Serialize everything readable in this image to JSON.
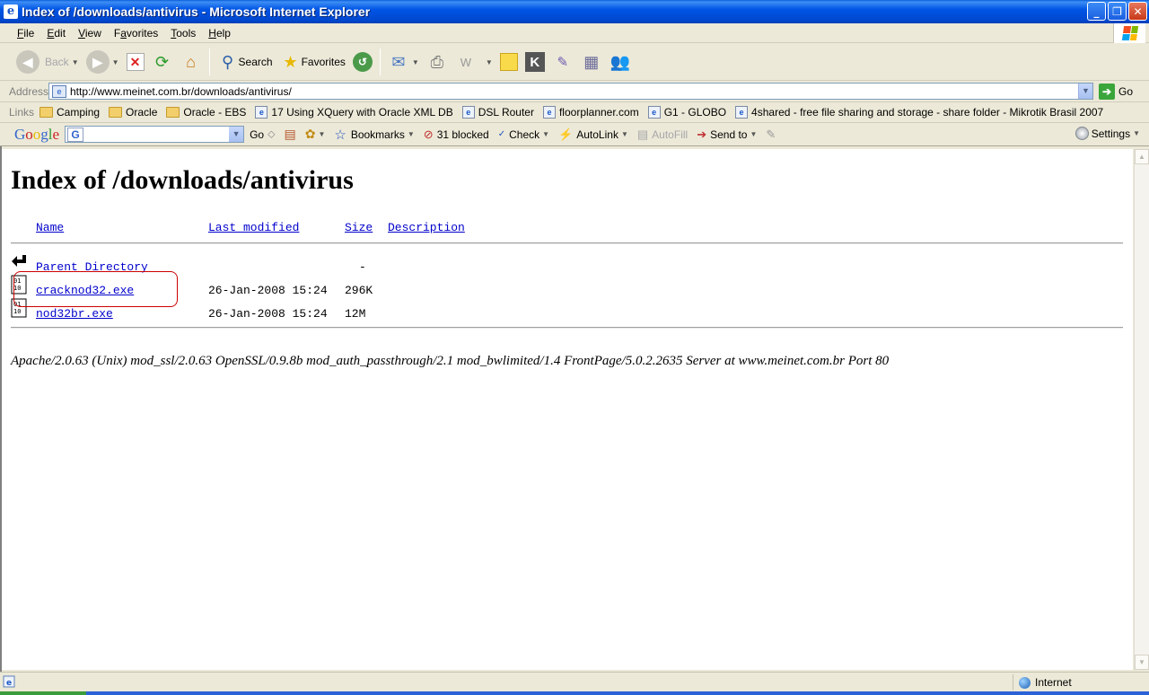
{
  "window": {
    "title": "Index of /downloads/antivirus - Microsoft Internet Explorer",
    "buttons": [
      "minimize",
      "maximize",
      "close"
    ]
  },
  "menubar": {
    "items": [
      {
        "label": "File",
        "u": "F",
        "rest": "ile"
      },
      {
        "label": "Edit",
        "u": "E",
        "rest": "dit"
      },
      {
        "label": "View",
        "u": "V",
        "rest": "iew"
      },
      {
        "label": "Favorites",
        "u": "a",
        "pre": "F",
        "rest": "vorites"
      },
      {
        "label": "Tools",
        "u": "T",
        "rest": "ools"
      },
      {
        "label": "Help",
        "u": "H",
        "rest": "elp"
      }
    ]
  },
  "toolbar": {
    "back_label": "Back",
    "search_label": "Search",
    "favorites_label": "Favorites"
  },
  "address": {
    "label": "Address",
    "url": "http://www.meinet.com.br/downloads/antivirus/",
    "go_label": "Go"
  },
  "links": {
    "label": "Links",
    "items": [
      {
        "label": "Camping",
        "icon": "folder-icon"
      },
      {
        "label": "Oracle",
        "icon": "folder-icon"
      },
      {
        "label": "Oracle - EBS",
        "icon": "folder-icon"
      },
      {
        "label": "17 Using XQuery with Oracle XML DB",
        "icon": "ie-page-icon"
      },
      {
        "label": "DSL Router",
        "icon": "ie-page-icon"
      },
      {
        "label": "floorplanner.com",
        "icon": "ie-page-icon"
      },
      {
        "label": "G1 - GLOBO",
        "icon": "ie-page-icon"
      },
      {
        "label": "4shared - free file sharing and storage - share folder - Mikrotik Brasil 2007",
        "icon": "ie-page-icon"
      }
    ]
  },
  "google_toolbar": {
    "logo": "Google",
    "search_value": "",
    "go_label": "Go",
    "bookmarks_label": "Bookmarks",
    "blocked_label": "31 blocked",
    "check_label": "Check",
    "autolink_label": "AutoLink",
    "autofill_label": "AutoFill",
    "sendto_label": "Send to",
    "settings_label": "Settings"
  },
  "page": {
    "heading": "Index of /downloads/antivirus",
    "columns": {
      "name": "Name",
      "last_modified": "Last modified",
      "size": "Size",
      "description": "Description"
    },
    "rows": [
      {
        "name": "Parent Directory",
        "modified": "",
        "size": "-",
        "icon": "back-arrow-icon"
      },
      {
        "name": "cracknod32.exe",
        "modified": "26-Jan-2008 15:24",
        "size": "296K",
        "icon": "binary-file-icon"
      },
      {
        "name": "nod32br.exe",
        "modified": "26-Jan-2008 15:24",
        "size": "12M",
        "icon": "binary-file-icon"
      }
    ],
    "footer": "Apache/2.0.63 (Unix) mod_ssl/2.0.63 OpenSSL/0.9.8b mod_auth_passthrough/2.1 mod_bwlimited/1.4 FrontPage/5.0.2.2635 Server at www.meinet.com.br Port 80"
  },
  "status": {
    "text": "",
    "zone": "Internet"
  },
  "colors": {
    "title_bar": "#0055e5",
    "link": "#0000cc",
    "annotation": "#cc0000"
  }
}
